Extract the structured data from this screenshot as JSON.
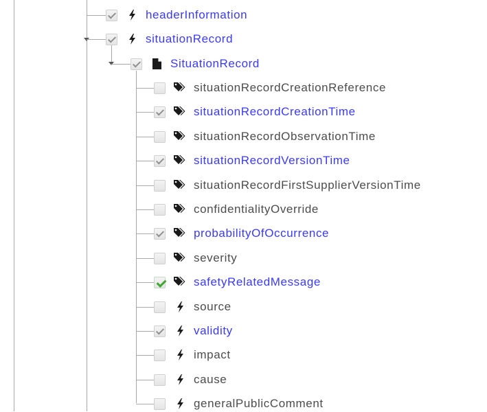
{
  "tree": {
    "level1": [
      {
        "label": "headerInformation",
        "checked": true,
        "link": true,
        "icon": "bolt-icon"
      },
      {
        "label": "situationRecord",
        "checked": true,
        "link": true,
        "icon": "bolt-icon",
        "expanded": true
      }
    ],
    "level2": [
      {
        "label": "SituationRecord",
        "checked": true,
        "link": true,
        "icon": "document-icon",
        "expanded": true
      }
    ],
    "level3": [
      {
        "label": "situationRecordCreationReference",
        "checked": false,
        "link": false,
        "icon": "tag-icon"
      },
      {
        "label": "situationRecordCreationTime",
        "checked": true,
        "link": true,
        "icon": "tag-icon"
      },
      {
        "label": "situationRecordObservationTime",
        "checked": false,
        "link": false,
        "icon": "tag-icon"
      },
      {
        "label": "situationRecordVersionTime",
        "checked": true,
        "link": true,
        "icon": "tag-icon"
      },
      {
        "label": "situationRecordFirstSupplierVersionTime",
        "checked": false,
        "link": false,
        "icon": "tag-icon"
      },
      {
        "label": "confidentialityOverride",
        "checked": false,
        "link": false,
        "icon": "tag-icon"
      },
      {
        "label": "probabilityOfOccurrence",
        "checked": true,
        "link": true,
        "icon": "tag-icon"
      },
      {
        "label": "severity",
        "checked": false,
        "link": false,
        "icon": "tag-icon"
      },
      {
        "label": "safetyRelatedMessage",
        "checked": true,
        "link": true,
        "icon": "tag-icon",
        "checkColor": "#3fa72f"
      },
      {
        "label": "source",
        "checked": false,
        "link": false,
        "icon": "bolt-icon"
      },
      {
        "label": "validity",
        "checked": true,
        "link": true,
        "icon": "bolt-icon"
      },
      {
        "label": "impact",
        "checked": false,
        "link": false,
        "icon": "bolt-icon"
      },
      {
        "label": "cause",
        "checked": false,
        "link": false,
        "icon": "bolt-icon"
      },
      {
        "label": "generalPublicComment",
        "checked": false,
        "link": false,
        "icon": "bolt-icon"
      }
    ]
  },
  "colors": {
    "link": "#3a3aff",
    "text": "#4c4c4c",
    "connector": "#a8a8a8",
    "check": "#8f8f8f",
    "check_green": "#3fa72f"
  }
}
